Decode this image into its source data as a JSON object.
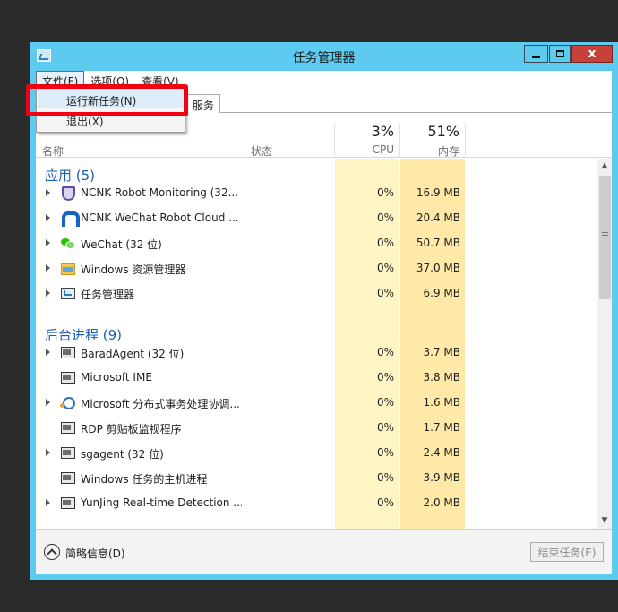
{
  "window": {
    "title": "任务管理器",
    "close_glyph": "x",
    "accent": "#5ccbef"
  },
  "menubar": {
    "file": "文件(F)",
    "options": "选项(O)",
    "view": "查看(V)"
  },
  "tabs": {
    "services": "服务"
  },
  "file_menu": {
    "items": [
      "运行新任务(N)",
      "退出(X)"
    ],
    "highlight_color": "#f00111"
  },
  "columns": {
    "name": "名称",
    "status": "状态",
    "cpu_percent": "3%",
    "cpu": "CPU",
    "mem_percent": "51%",
    "mem": "内存"
  },
  "groups": [
    {
      "title": "应用 (5)",
      "rows": [
        {
          "name": "NCNK Robot Monitoring (32...",
          "cpu": "0%",
          "mem": "16.9 MB",
          "icon": "shield-icon",
          "expandable": true
        },
        {
          "name": "NCNK WeChat Robot Cloud ...",
          "cpu": "0%",
          "mem": "20.4 MB",
          "icon": "magnet-icon",
          "expandable": true
        },
        {
          "name": "WeChat (32 位)",
          "cpu": "0%",
          "mem": "50.7 MB",
          "icon": "wechat-icon",
          "expandable": true
        },
        {
          "name": "Windows 资源管理器",
          "cpu": "0%",
          "mem": "37.0 MB",
          "icon": "folder-icon",
          "expandable": true
        },
        {
          "name": "任务管理器",
          "cpu": "0%",
          "mem": "6.9 MB",
          "icon": "task-manager-icon",
          "expandable": true
        }
      ]
    },
    {
      "title": "后台进程 (9)",
      "rows": [
        {
          "name": "BaradAgent (32 位)",
          "cpu": "0%",
          "mem": "3.7 MB",
          "icon": "window-icon",
          "expandable": true
        },
        {
          "name": "Microsoft IME",
          "cpu": "0%",
          "mem": "3.8 MB",
          "icon": "window-icon",
          "expandable": false
        },
        {
          "name": "Microsoft 分布式事务处理协调...",
          "cpu": "0%",
          "mem": "1.6 MB",
          "icon": "network-icon",
          "expandable": true
        },
        {
          "name": "RDP 剪贴板监视程序",
          "cpu": "0%",
          "mem": "1.7 MB",
          "icon": "window-icon",
          "expandable": false
        },
        {
          "name": "sgagent (32 位)",
          "cpu": "0%",
          "mem": "2.4 MB",
          "icon": "window-icon",
          "expandable": true
        },
        {
          "name": "Windows 任务的主机进程",
          "cpu": "0%",
          "mem": "3.9 MB",
          "icon": "window-icon",
          "expandable": false
        },
        {
          "name": "YunJing Real-time Detection ...",
          "cpu": "0%",
          "mem": "2.0 MB",
          "icon": "window-icon",
          "expandable": true
        }
      ]
    }
  ],
  "footer": {
    "fewer_details": "简略信息(D)",
    "end_task": "结束任务(E)"
  },
  "colors": {
    "cpu_column": "#fff4c4",
    "mem_column": "#ffe9a8",
    "group_title": "#1a5fb4"
  }
}
